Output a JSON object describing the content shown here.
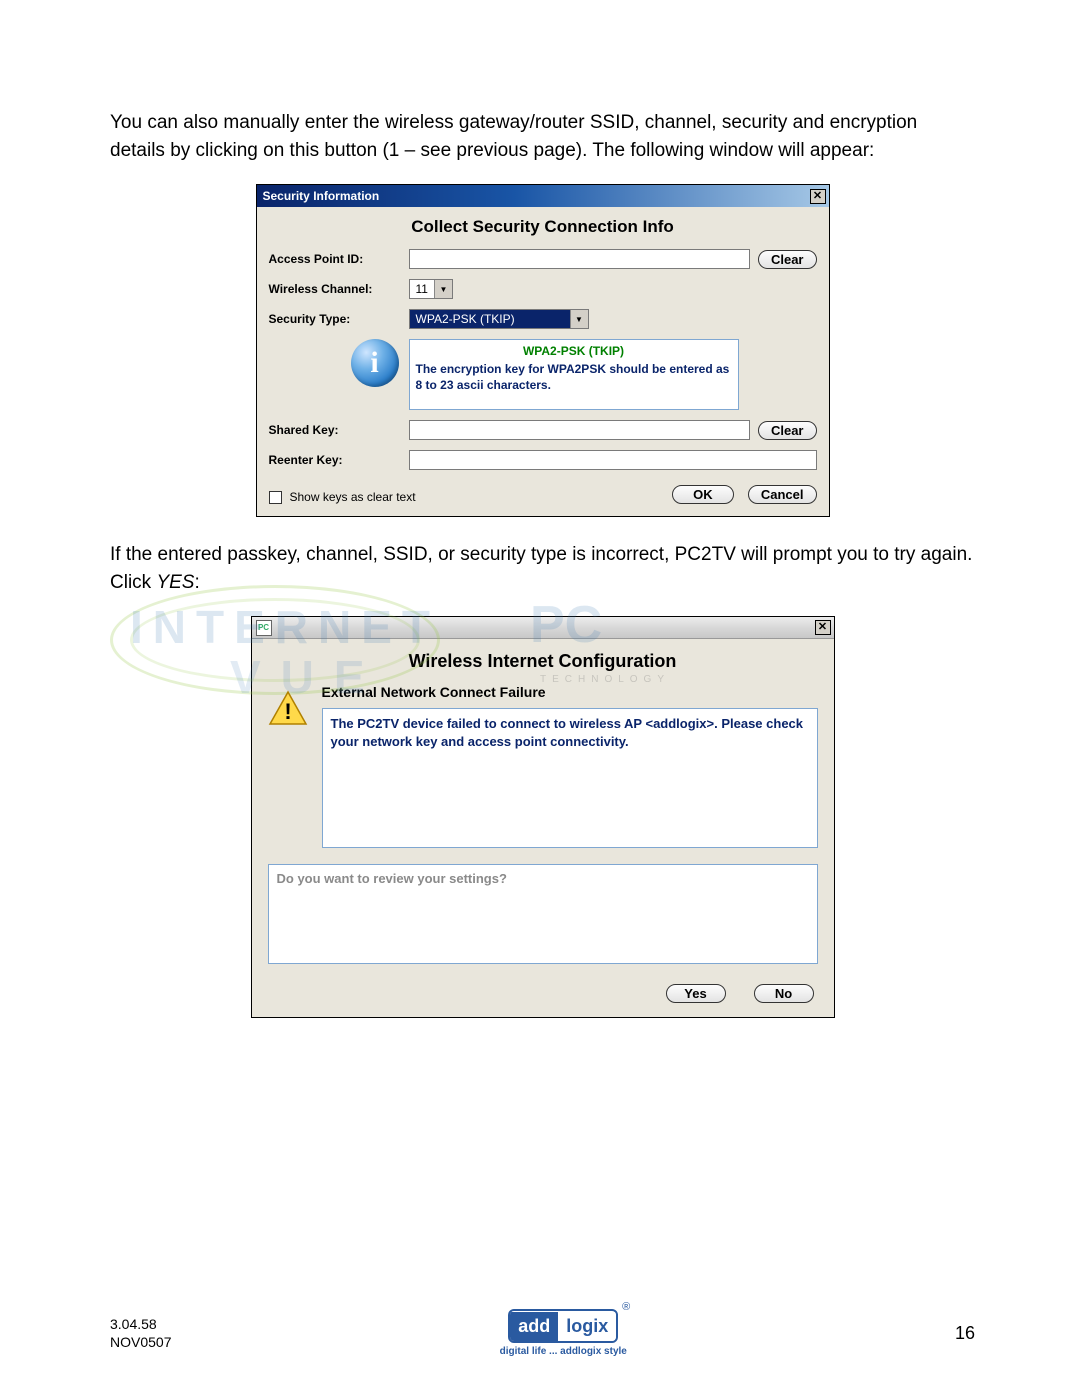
{
  "body": {
    "para1": "You can also manually enter the wireless gateway/router SSID, channel, security and encryption details by clicking on this button (1 – see previous page).  The following window will appear:",
    "para2_a": "If the entered passkey, channel, SSID, or security type is incorrect, PC2TV will prompt you to try again.  Click ",
    "para2_yes": "YES",
    "para2_b": ":"
  },
  "dialog1": {
    "title": "Security Information",
    "heading": "Collect Security Connection Info",
    "labels": {
      "access_point": "Access Point ID:",
      "channel": "Wireless Channel:",
      "security_type": "Security Type:",
      "shared_key": "Shared Key:",
      "reenter_key": "Reenter Key:"
    },
    "values": {
      "access_point": "",
      "channel": "11",
      "security_type": "WPA2-PSK (TKIP)",
      "shared_key": "",
      "reenter_key": ""
    },
    "info": {
      "title": "WPA2-PSK (TKIP)",
      "text": "The encryption key for WPA2PSK should be entered as 8 to 23 ascii characters."
    },
    "checkbox": "Show keys as clear text",
    "buttons": {
      "clear": "Clear",
      "ok": "OK",
      "cancel": "Cancel"
    }
  },
  "dialog2": {
    "heading": "Wireless Internet Configuration",
    "subheading": "External Network Connect Failure",
    "message": "The PC2TV device failed to connect to wireless AP <addlogix>.  Please check your network key and access point connectivity.",
    "review": "Do you want to review your settings?",
    "buttons": {
      "yes": "Yes",
      "no": "No"
    }
  },
  "watermark": {
    "internet": "INTERNET",
    "vue": "VUE",
    "pc": "PC",
    "tech": "TECHNOLOGY"
  },
  "footer": {
    "version": "3.04.58",
    "date": "NOV0507",
    "logo_left": "add",
    "logo_right": "logix",
    "tagline": "digital life ... addlogix style",
    "page": "16"
  }
}
